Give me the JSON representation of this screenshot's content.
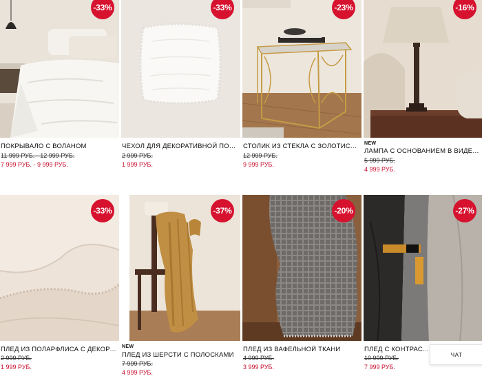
{
  "products": [
    {
      "name": "ПОКРЫВАЛО С ВОЛАНОМ",
      "discount": "-33%",
      "old_price": "11 999 РУБ. - 12 999 РУБ.",
      "price": "7 999 РУБ. - 9 999 РУБ.",
      "is_new": false,
      "new_label": ""
    },
    {
      "name": "ЧЕХОЛ ДЛЯ ДЕКОРАТИВНОЙ ПОДУ...",
      "discount": "-33%",
      "old_price": "2 999 РУБ.",
      "price": "1 999 РУБ.",
      "is_new": false,
      "new_label": ""
    },
    {
      "name": "СТОЛИК ИЗ СТЕКЛА С ЗОЛОТИСТЫ...",
      "discount": "-23%",
      "old_price": "12 999 РУБ.",
      "price": "9 999 РУБ.",
      "is_new": false,
      "new_label": ""
    },
    {
      "name": "ЛАМПА С ОСНОВАНИЕМ В ВИДЕ КО...",
      "discount": "-16%",
      "old_price": "5 999 РУБ.",
      "price": "4 999 РУБ.",
      "is_new": true,
      "new_label": "NEW"
    },
    {
      "name": "ПЛЕД ИЗ ПОЛАРФЛИСА С ДЕКОРАТ...",
      "discount": "-33%",
      "old_price": "2 999 РУБ.",
      "price": "1 999 РУБ.",
      "is_new": false,
      "new_label": ""
    },
    {
      "name": "ПЛЕД ИЗ ШЕРСТИ С ПОЛОСКАМИ",
      "discount": "-37%",
      "old_price": "7 999 РУБ.",
      "price": "4 999 РУБ.",
      "is_new": true,
      "new_label": "NEW"
    },
    {
      "name": "ПЛЕД ИЗ ВАФЕЛЬНОЙ ТКАНИ",
      "discount": "-20%",
      "old_price": "4 999 РУБ.",
      "price": "3 999 РУБ.",
      "is_new": false,
      "new_label": ""
    },
    {
      "name": "ПЛЕД С КОНТРАСТНО",
      "discount": "-27%",
      "old_price": "10 999 РУБ.",
      "price": "7 999 РУБ.",
      "is_new": false,
      "new_label": ""
    }
  ],
  "chat": {
    "label": "ЧАТ"
  },
  "colors": {
    "badge": "#d6122f",
    "sale_price": "#c8102e"
  }
}
